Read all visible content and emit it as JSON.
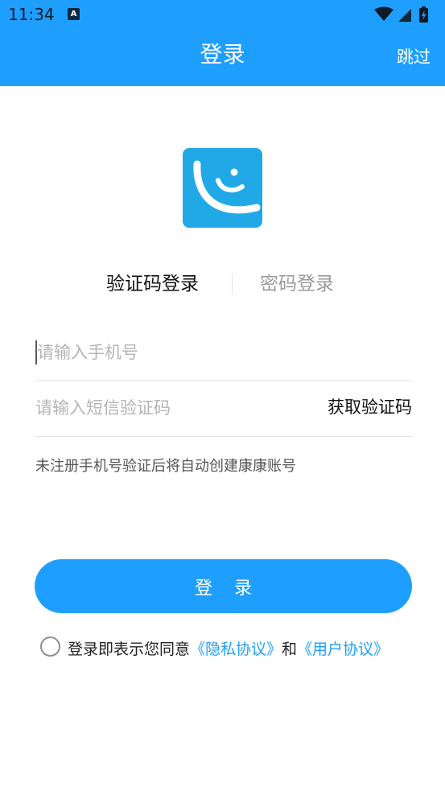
{
  "status": {
    "time": "11:34",
    "notif_badge": "A"
  },
  "appbar": {
    "title": "登录",
    "skip": "跳过"
  },
  "tabs": [
    {
      "label": "验证码登录",
      "active": true
    },
    {
      "label": "密码登录",
      "active": false
    }
  ],
  "form": {
    "phone_placeholder": "请输入手机号",
    "code_placeholder": "请输入短信验证码",
    "get_code": "获取验证码",
    "hint": "未注册手机号验证后将自动创建康康账号"
  },
  "login_button": "登 录",
  "agreement": {
    "prefix": "登录即表示您同意",
    "privacy": "《隐私协议》",
    "and": "和",
    "user": "《用户协议》"
  },
  "colors": {
    "primary": "#1E9FFF",
    "logo_bg": "#21A9E7"
  }
}
